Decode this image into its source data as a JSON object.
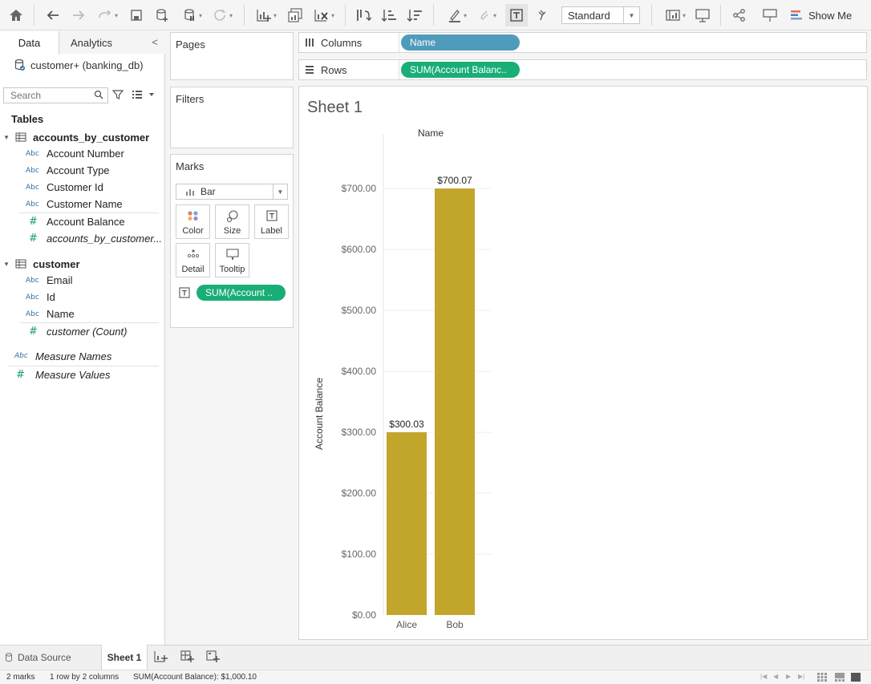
{
  "toolbar": {
    "mark_size_mode": "Standard",
    "show_me_label": "Show Me"
  },
  "data_pane": {
    "tab_data": "Data",
    "tab_analytics": "Analytics",
    "datasource": "customer+ (banking_db)",
    "search_placeholder": "Search",
    "tables_heading": "Tables",
    "groups": [
      {
        "name": "accounts_by_customer",
        "dimensions": [
          {
            "type": "Abc",
            "name": "Account Number"
          },
          {
            "type": "Abc",
            "name": "Account Type"
          },
          {
            "type": "Abc",
            "name": "Customer Id"
          },
          {
            "type": "Abc",
            "name": "Customer Name"
          }
        ],
        "measures": [
          {
            "type": "#",
            "name": "Account Balance"
          },
          {
            "type": "#",
            "name": "accounts_by_customer..."
          }
        ]
      },
      {
        "name": "customer",
        "dimensions": [
          {
            "type": "Abc",
            "name": "Email"
          },
          {
            "type": "Abc",
            "name": "Id"
          },
          {
            "type": "Abc",
            "name": "Name"
          }
        ],
        "measures": [
          {
            "type": "#",
            "name": "customer (Count)"
          }
        ]
      }
    ],
    "measure_names": {
      "type": "Abc",
      "name": "Measure Names"
    },
    "measure_values": {
      "type": "#",
      "name": "Measure Values"
    }
  },
  "cards": {
    "pages": "Pages",
    "filters": "Filters",
    "marks": "Marks",
    "mark_type": "Bar",
    "buttons": [
      "Color",
      "Size",
      "Label",
      "Detail",
      "Tooltip"
    ],
    "mark_pill": "SUM(Account .."
  },
  "shelves": {
    "columns_label": "Columns",
    "columns_pill": "Name",
    "rows_label": "Rows",
    "rows_pill": "SUM(Account Balanc.."
  },
  "sheet": {
    "title": "Sheet 1",
    "column_header": "Name"
  },
  "chart_data": {
    "type": "bar",
    "categories": [
      "Alice",
      "Bob"
    ],
    "values": [
      300.03,
      700.07
    ],
    "value_labels": [
      "$300.03",
      "$700.07"
    ],
    "ylabel": "Account Balance",
    "xlabel": "Name",
    "ylim": [
      0,
      776.56
    ],
    "yticks": [
      0,
      100,
      200,
      300,
      400,
      500,
      600,
      700
    ],
    "ytick_labels": [
      "$0.00",
      "$100.00",
      "$200.00",
      "$300.00",
      "$400.00",
      "$500.00",
      "$600.00",
      "$700.00"
    ],
    "bar_color": "#c2a52b",
    "grid": true
  },
  "bottom_tabs": {
    "data_source": "Data Source",
    "sheet1": "Sheet 1"
  },
  "status": {
    "marks": "2 marks",
    "dims": "1 row by 2 columns",
    "sum": "SUM(Account Balance): $1,000.10"
  }
}
